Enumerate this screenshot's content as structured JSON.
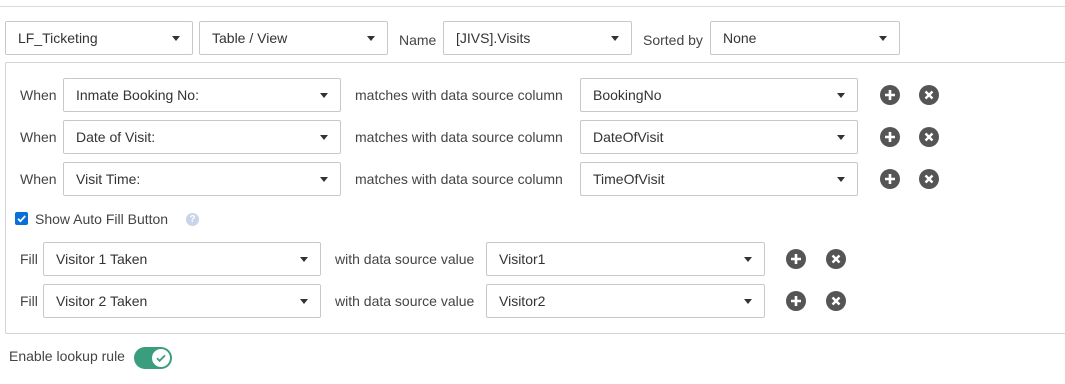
{
  "top": {
    "repository": "LF_Ticketing",
    "source_type": "Table / View",
    "name_label": "Name",
    "name_value": "[JIVS].Visits",
    "sorted_label": "Sorted by",
    "sorted_value": "None"
  },
  "conditions": [
    {
      "when": "When",
      "field": "Inmate Booking No:",
      "matches": "matches with data source column",
      "column": "BookingNo"
    },
    {
      "when": "When",
      "field": "Date of Visit:",
      "matches": "matches with data source column",
      "column": "DateOfVisit"
    },
    {
      "when": "When",
      "field": "Visit Time:",
      "matches": "matches with data source column",
      "column": "TimeOfVisit"
    }
  ],
  "autofill": {
    "label": "Show Auto Fill Button",
    "checked": true
  },
  "fills": [
    {
      "fill": "Fill",
      "field": "Visitor 1 Taken",
      "with": "with data source value",
      "value": "Visitor1"
    },
    {
      "fill": "Fill",
      "field": "Visitor 2 Taken",
      "with": "with data source value",
      "value": "Visitor2"
    }
  ],
  "footer": {
    "enable_label": "Enable lookup rule",
    "enabled": true
  },
  "colors": {
    "checkbox": "#0a6fd6",
    "toggle": "#3a9e7e",
    "icon_button": "#555555"
  },
  "icons": {
    "add": "plus-circle-icon",
    "remove": "x-circle-icon",
    "help": "question-circle-icon",
    "dropdown": "chevron-down-icon"
  }
}
